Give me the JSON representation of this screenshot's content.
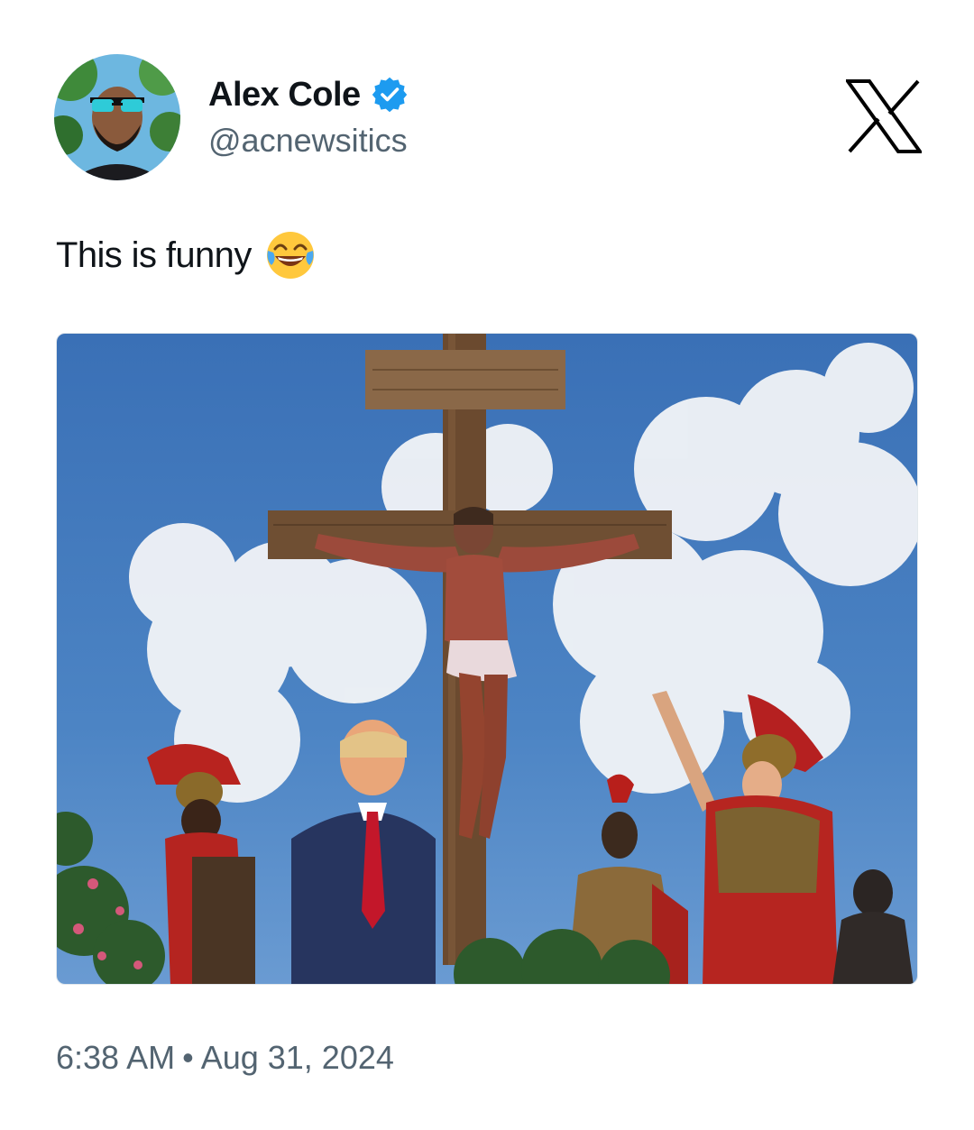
{
  "author": {
    "display_name": "Alex Cole",
    "handle": "@acnewsitics",
    "verified": true,
    "verified_icon": "verified-badge-icon"
  },
  "platform": {
    "logo_icon": "x-logo-icon"
  },
  "tweet": {
    "text": "This is funny",
    "emoji": "face-with-tears-of-joy"
  },
  "timestamp": {
    "time": "6:38 AM",
    "separator": "•",
    "date": "Aug 31, 2024"
  },
  "colors": {
    "verified_blue": "#1d9bf0",
    "text_primary": "#0f1419",
    "text_secondary": "#536471"
  }
}
